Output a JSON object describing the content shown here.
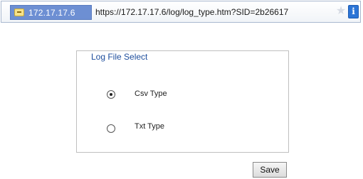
{
  "browser": {
    "site_host": "172.17.17.6",
    "url": "https://172.17.17.6/log/log_type.htm?SID=2b26617",
    "star_icon": "star-icon",
    "info_icon": "info-icon"
  },
  "log_file_select": {
    "legend": "Log File Select",
    "options": [
      {
        "label": "Csv Type",
        "selected": true
      },
      {
        "label": "Txt Type",
        "selected": false
      }
    ]
  },
  "actions": {
    "save_label": "Save"
  }
}
